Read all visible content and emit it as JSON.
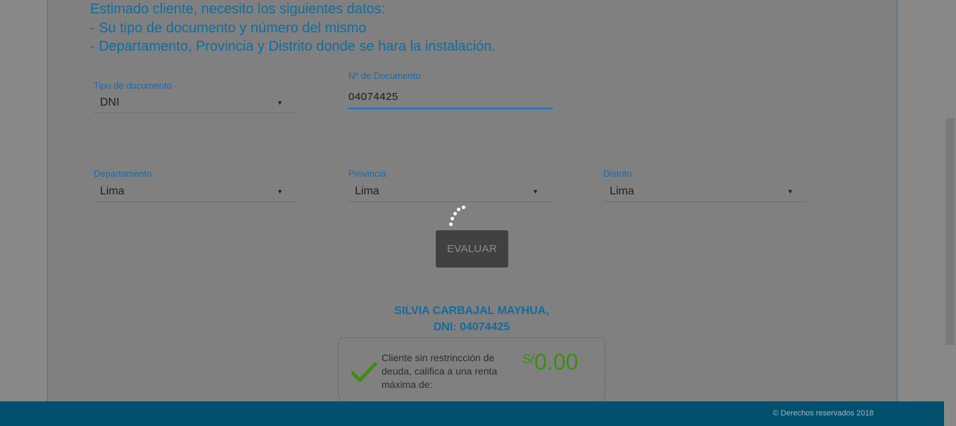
{
  "intro": {
    "line1": "Estimado cliente, necesito los siguientes datos:",
    "line2": "- Su tipo de documento y número del mismo",
    "line3": "- Departamento, Provincia y Distrito donde se hara la instalación."
  },
  "form": {
    "doc_type_label": "Tipo de documento",
    "doc_type_value": "DNI",
    "doc_number_label": "Nº de Documento",
    "doc_number_value": "04074425",
    "departamento_label": "Departamento",
    "departamento_value": "Lima",
    "provincia_label": "Provincia",
    "provincia_value": "Lima",
    "distrito_label": "Distrito",
    "distrito_value": "Lima",
    "caret": "▼"
  },
  "evaluar_label": "EVALUAR",
  "result": {
    "customer_name": "SILVIA CARBAJAL MAYHUA,",
    "customer_dni": "DNI: 04074425",
    "message": "Cliente sin restrincción de deuda, califica a una renta máxima de:",
    "currency": "S/",
    "amount": "0.00",
    "amount_color": "#3f8c12",
    "check_icon": "check-icon"
  },
  "footer": {
    "copyright": "© Derechos reservados 2018"
  },
  "colors": {
    "accent": "#0f6e9e",
    "footer": "#01506e"
  }
}
